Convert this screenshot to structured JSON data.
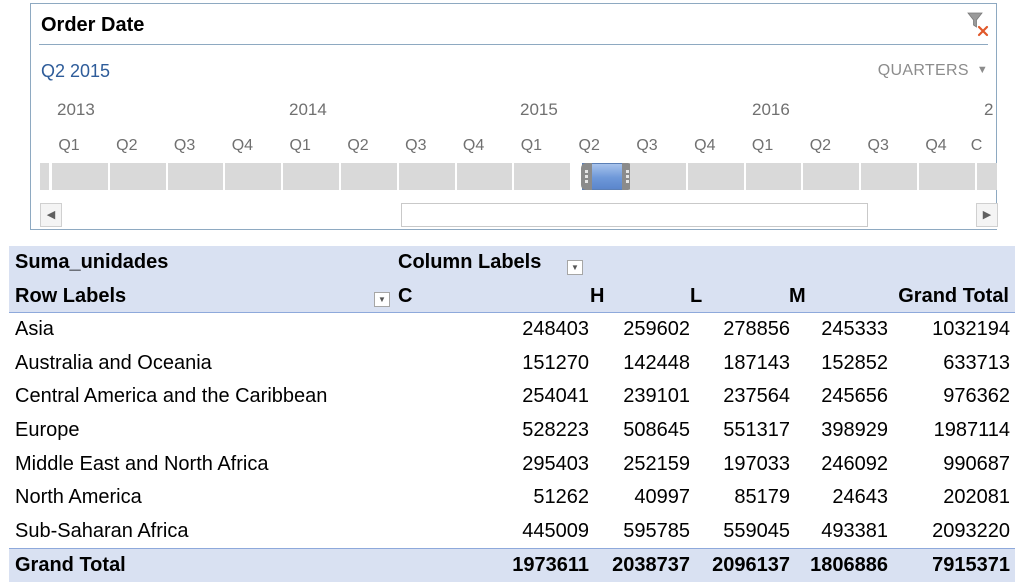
{
  "slicer": {
    "title": "Order Date",
    "clear_filter_icon": "filter-clear-icon",
    "selection": "Q2 2015",
    "level": "QUARTERS",
    "years": [
      "2013",
      "2014",
      "2015",
      "2016",
      "2"
    ],
    "quarters": [
      "Q1",
      "Q2",
      "Q3",
      "Q4",
      "Q1",
      "Q2",
      "Q3",
      "Q4",
      "Q1",
      "Q2",
      "Q3",
      "Q4",
      "Q1",
      "Q2",
      "Q3",
      "Q4",
      "C"
    ],
    "selected_quarter_index": 9,
    "accent": "#6e98d9"
  },
  "pivot": {
    "value_field": "Suma_unidades",
    "column_labels": "Column Labels",
    "row_labels": "Row Labels",
    "columns": [
      "C",
      "H",
      "L",
      "M",
      "Grand Total"
    ],
    "rows": [
      {
        "label": "Asia",
        "values": [
          "248403",
          "259602",
          "278856",
          "245333",
          "1032194"
        ]
      },
      {
        "label": "Australia and Oceania",
        "values": [
          "151270",
          "142448",
          "187143",
          "152852",
          "633713"
        ]
      },
      {
        "label": "Central America and the Caribbean",
        "values": [
          "254041",
          "239101",
          "237564",
          "245656",
          "976362"
        ]
      },
      {
        "label": "Europe",
        "values": [
          "528223",
          "508645",
          "551317",
          "398929",
          "1987114"
        ]
      },
      {
        "label": "Middle East and North Africa",
        "values": [
          "295403",
          "252159",
          "197033",
          "246092",
          "990687"
        ]
      },
      {
        "label": "North America",
        "values": [
          "51262",
          "40997",
          "85179",
          "24643",
          "202081"
        ]
      },
      {
        "label": "Sub-Saharan Africa",
        "values": [
          "445009",
          "595785",
          "559045",
          "493381",
          "2093220"
        ]
      }
    ],
    "grand_total": {
      "label": "Grand Total",
      "values": [
        "1973611",
        "2038737",
        "2096137",
        "1806886",
        "7915371"
      ]
    },
    "header_color": "#d9e1f2"
  }
}
